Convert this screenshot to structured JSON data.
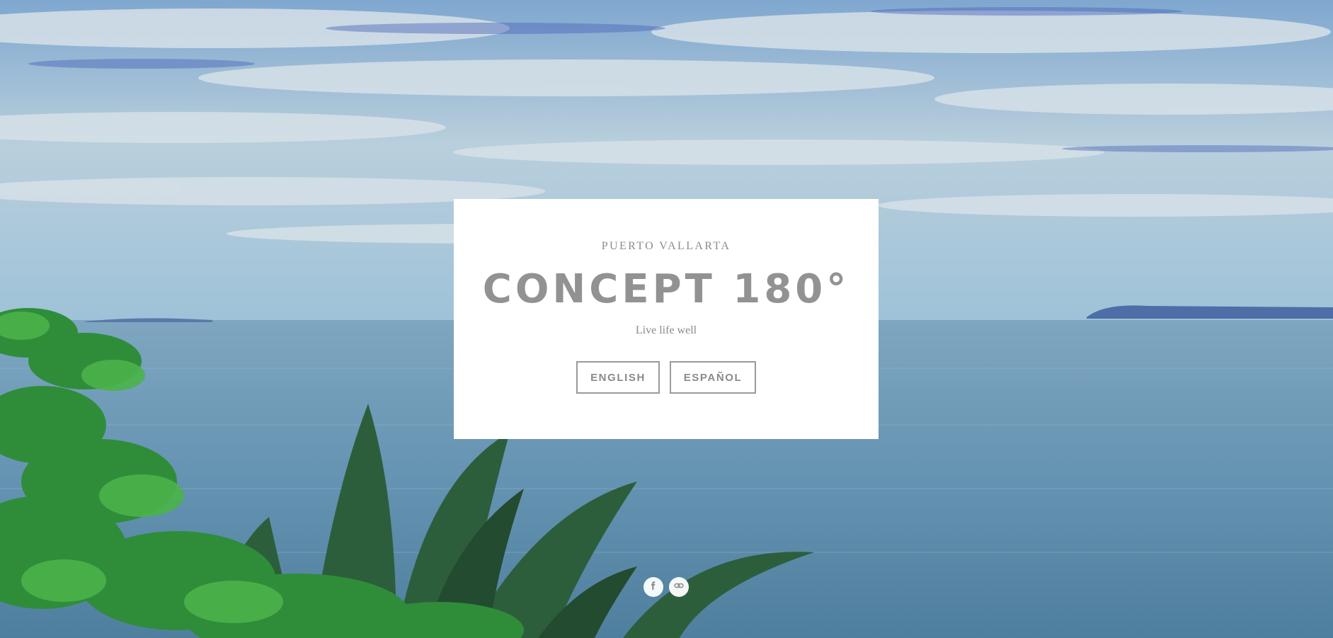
{
  "hero": {
    "background": "ocean-view-with-palms"
  },
  "card": {
    "eyebrow": "PUERTO VALLARTA",
    "title": "CONCEPT 180°",
    "tagline": "Live life well",
    "buttons": [
      {
        "label": "ENGLISH"
      },
      {
        "label": "ESPAÑOL"
      }
    ]
  },
  "social": {
    "icons": [
      "facebook-icon",
      "link-icon"
    ]
  },
  "colors": {
    "card_text": "#929292",
    "button_border": "#9a9a9a",
    "sky": "#8fb6d3",
    "ocean": "#5f8fae"
  }
}
